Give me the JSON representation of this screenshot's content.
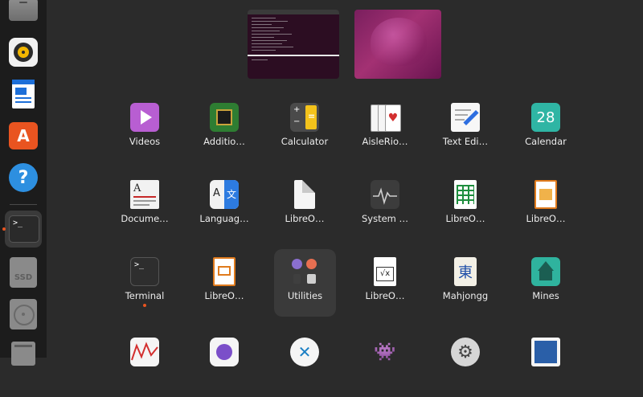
{
  "dock": {
    "items": [
      {
        "name": "files",
        "icon": "file-manager-icon"
      },
      {
        "name": "rhythmbox",
        "icon": "music-player-icon"
      },
      {
        "name": "libreoffice-writer",
        "icon": "writer-document-icon"
      },
      {
        "name": "app-center",
        "icon": "app-store-icon"
      },
      {
        "name": "help",
        "icon": "help-icon",
        "glyph": "?"
      },
      {
        "name": "terminal",
        "icon": "terminal-icon",
        "glyph": ">_"
      },
      {
        "name": "ssd-drive",
        "icon": "drive-icon",
        "glyph": "SSD"
      },
      {
        "name": "optical-drive",
        "icon": "disc-icon"
      },
      {
        "name": "trash",
        "icon": "trash-icon"
      }
    ]
  },
  "workspaces": [
    {
      "name": "workspace-1",
      "content": "terminal window"
    },
    {
      "name": "workspace-2",
      "content": "wallpaper"
    }
  ],
  "apps": [
    {
      "label": "Videos",
      "icon": "video-player-icon"
    },
    {
      "label": "Additio…",
      "icon": "chip-icon"
    },
    {
      "label": "Calculator",
      "icon": "calculator-icon"
    },
    {
      "label": "AisleRio…",
      "icon": "playing-cards-icon"
    },
    {
      "label": "Text Edi…",
      "icon": "text-editor-icon"
    },
    {
      "label": "Calendar",
      "icon": "calendar-icon",
      "glyph": "28"
    },
    {
      "label": "Docume…",
      "icon": "document-viewer-icon",
      "glyph": "A"
    },
    {
      "label": "Languag…",
      "icon": "language-icon",
      "glyph": "A 文"
    },
    {
      "label": "LibreO…",
      "icon": "libreoffice-icon"
    },
    {
      "label": "System …",
      "icon": "system-monitor-icon"
    },
    {
      "label": "LibreO…",
      "icon": "libreoffice-calc-icon"
    },
    {
      "label": "LibreO…",
      "icon": "libreoffice-impress-icon"
    },
    {
      "label": "Terminal",
      "icon": "terminal-icon",
      "glyph": ">_"
    },
    {
      "label": "LibreO…",
      "icon": "libreoffice-impress-icon"
    },
    {
      "label": "Utilities",
      "icon": "folder-icon"
    },
    {
      "label": "LibreO…",
      "icon": "libreoffice-math-icon",
      "glyph": "√x"
    },
    {
      "label": "Mahjongg",
      "icon": "mahjongg-tile-icon",
      "glyph": "東"
    },
    {
      "label": "Mines",
      "icon": "mines-icon"
    },
    {
      "label": "",
      "icon": "usage-monitor-icon"
    },
    {
      "label": "",
      "icon": "camera-icon"
    },
    {
      "label": "",
      "icon": "remote-desktop-icon"
    },
    {
      "label": "",
      "icon": "game-icon"
    },
    {
      "label": "",
      "icon": "settings-icon"
    },
    {
      "label": "",
      "icon": "image-viewer-icon"
    }
  ],
  "colors": {
    "accent": "#e95420",
    "background": "#2b2b2b",
    "dock": "#1c1c1c"
  }
}
